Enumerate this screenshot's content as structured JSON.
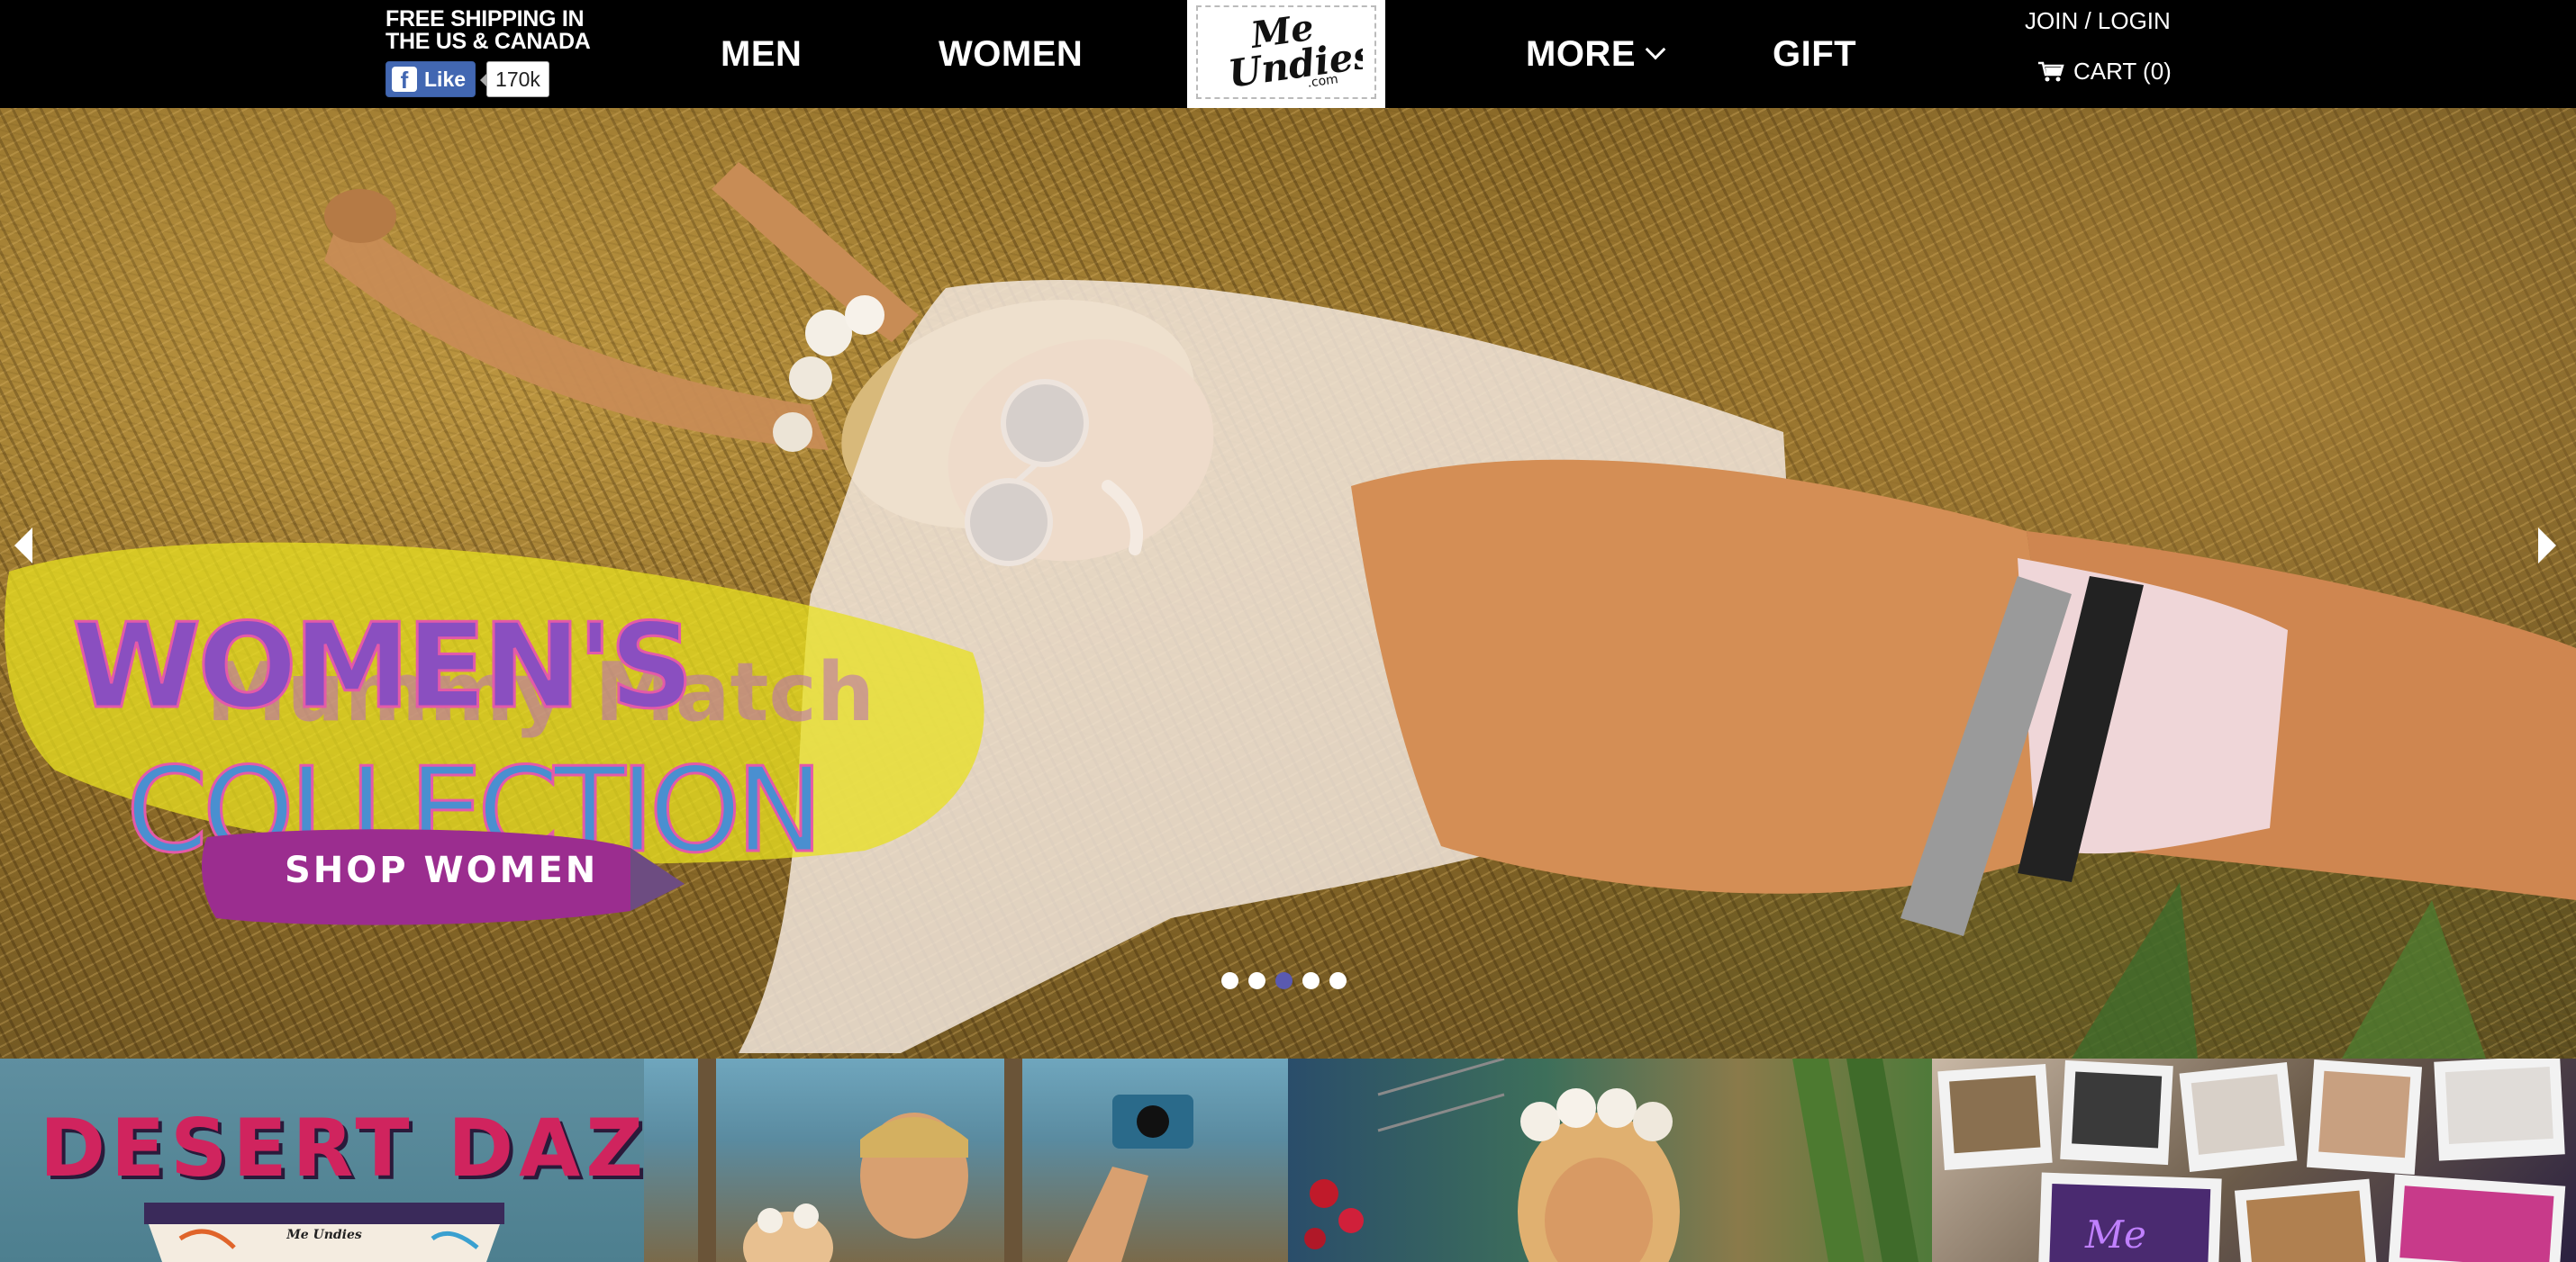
{
  "header": {
    "shipping_line1": "FREE SHIPPING IN",
    "shipping_line2": "THE US & CANADA",
    "fb_like_label": "Like",
    "fb_like_count": "170k",
    "nav": {
      "men": "MEN",
      "women": "WOMEN",
      "more": "MORE",
      "gift": "GIFT"
    },
    "logo_text": "MeUndies.com",
    "join_login": "JOIN / LOGIN",
    "cart": "CART (0)"
  },
  "hero": {
    "banner_line1": "WOMEN'S",
    "banner_overlay": "Mummy Match",
    "banner_line2": "COLLECTION",
    "cta_label": "SHOP WOMEN",
    "slides_total": 5,
    "active_slide": 3
  },
  "tiles": {
    "tile1_title": "DESERT DAZE",
    "tile1_logo": "Me Undies"
  },
  "colors": {
    "header_bg": "#000000",
    "banner_yellow": "#e8e020",
    "cta_purple": "#9b2d8f",
    "active_dot": "#5a5ab0",
    "desert_pink": "#d0245e"
  },
  "icons": [
    "facebook-icon",
    "chevron-down-icon",
    "cart-icon",
    "arrow-left-icon",
    "arrow-right-icon"
  ]
}
